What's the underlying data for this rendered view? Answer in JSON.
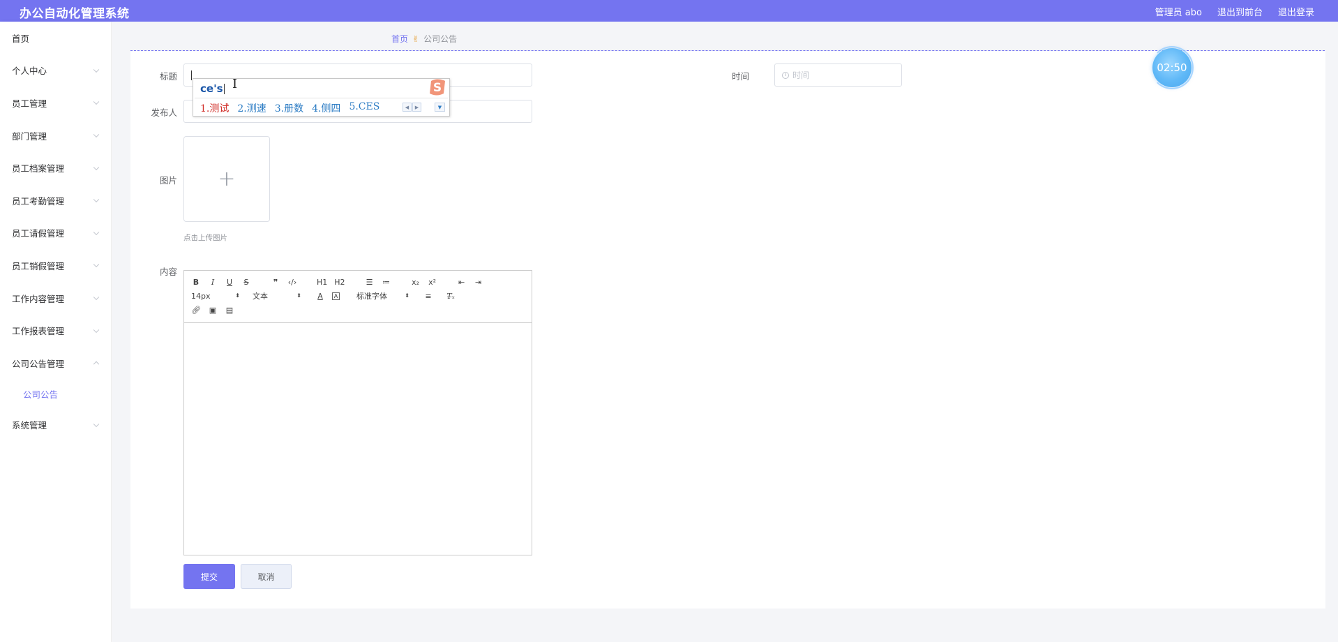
{
  "header": {
    "app_title": "办公自动化管理系统",
    "user_label": "管理员 abo",
    "front_link": "退出到前台",
    "logout_link": "退出登录"
  },
  "sidebar": {
    "items": [
      {
        "label": "首页",
        "has_children": false
      },
      {
        "label": "个人中心",
        "has_children": true
      },
      {
        "label": "员工管理",
        "has_children": true
      },
      {
        "label": "部门管理",
        "has_children": true
      },
      {
        "label": "员工档案管理",
        "has_children": true
      },
      {
        "label": "员工考勤管理",
        "has_children": true
      },
      {
        "label": "员工请假管理",
        "has_children": true
      },
      {
        "label": "员工销假管理",
        "has_children": true
      },
      {
        "label": "工作内容管理",
        "has_children": true
      },
      {
        "label": "工作报表管理",
        "has_children": true
      },
      {
        "label": "公司公告管理",
        "has_children": true,
        "expanded": true
      },
      {
        "label": "系统管理",
        "has_children": true
      }
    ],
    "active_submenu": "公司公告"
  },
  "breadcrumb": {
    "home": "首页",
    "current": "公司公告"
  },
  "form": {
    "title_label": "标题",
    "title_value": "",
    "time_label": "时间",
    "time_placeholder": "时间",
    "publisher_label": "发布人",
    "image_label": "图片",
    "upload_tip": "点击上传图片",
    "content_label": "内容",
    "submit": "提交",
    "cancel": "取消"
  },
  "editor_toolbar": {
    "font_size": "14px",
    "header_select": "文本",
    "font_family": "标准字体",
    "h1": "H1",
    "h2": "H2"
  },
  "ime": {
    "composition": "ce's",
    "candidates": [
      "1.测试",
      "2.测速",
      "3.册数",
      "4.侧四",
      "5.CES"
    ]
  },
  "timer": {
    "value": "02:50"
  },
  "colors": {
    "primary": "#7474f0",
    "timer": "#5fb8f7",
    "ime_red": "#d2312b",
    "ime_blue": "#2c7cc4"
  }
}
